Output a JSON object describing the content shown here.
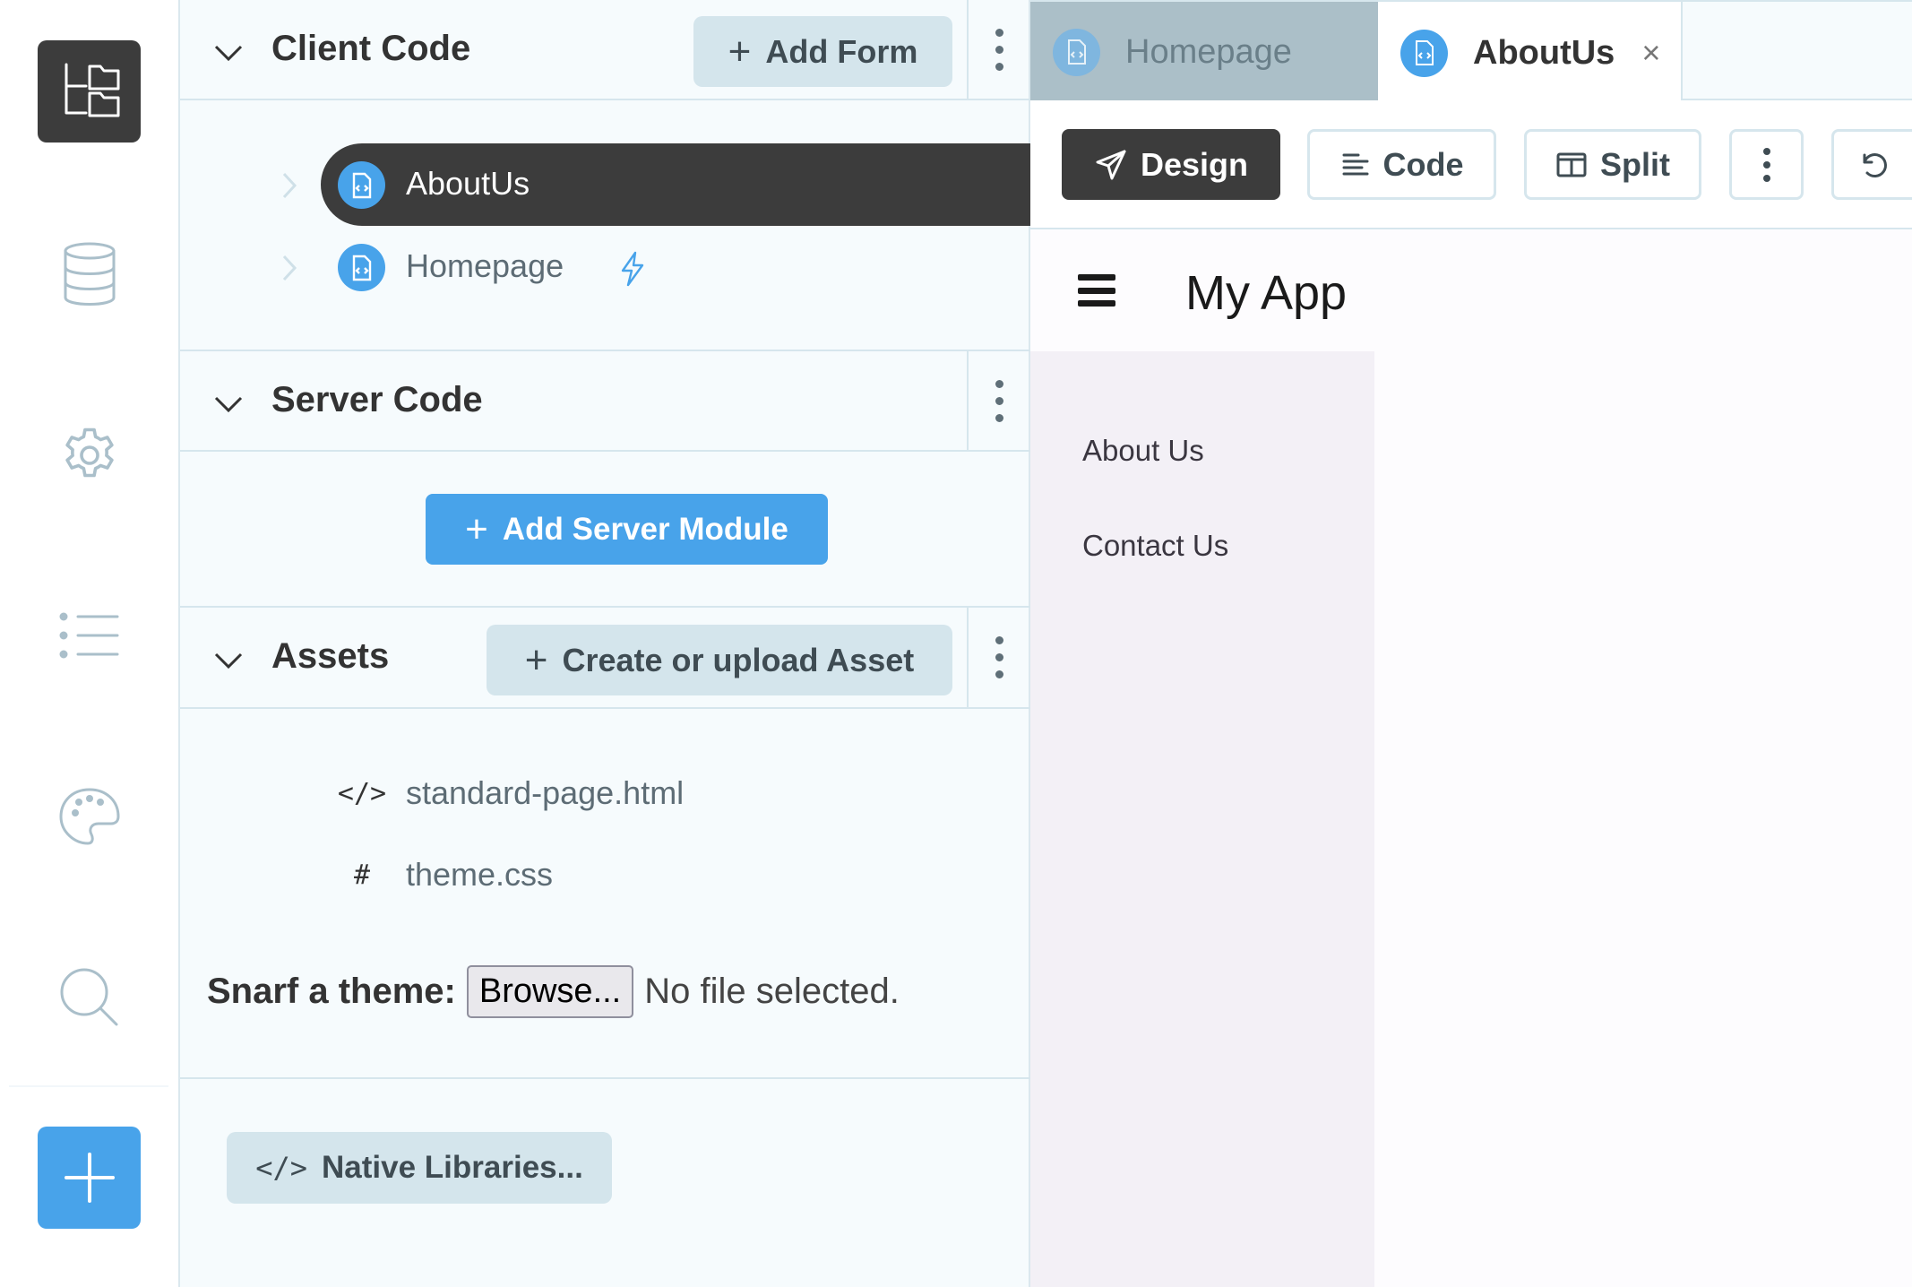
{
  "sidebar": {
    "items": [
      {
        "name": "files",
        "icon": "folder-tree-icon",
        "active": true
      },
      {
        "name": "data",
        "icon": "database-icon"
      },
      {
        "name": "settings",
        "icon": "gear-icon"
      },
      {
        "name": "list",
        "icon": "list-icon"
      },
      {
        "name": "theme",
        "icon": "palette-icon"
      },
      {
        "name": "search",
        "icon": "search-icon"
      }
    ],
    "add_icon": "plus-icon"
  },
  "client_code": {
    "title": "Client Code",
    "add_button": "Add Form",
    "forms": [
      {
        "label": "AboutUs",
        "selected": true
      },
      {
        "label": "Homepage",
        "startup": true,
        "startup_icon": "lightning-icon"
      }
    ]
  },
  "server_code": {
    "title": "Server Code",
    "add_button": "Add Server Module"
  },
  "assets": {
    "title": "Assets",
    "add_button": "Create or upload Asset",
    "files": [
      {
        "icon": "</>",
        "label": "standard-page.html"
      },
      {
        "icon": "#",
        "label": "theme.css"
      }
    ],
    "snarf_label": "Snarf a theme:",
    "browse_label": "Browse...",
    "no_file_text": "No file selected."
  },
  "native_libraries": {
    "icon": "</>",
    "label": "Native Libraries..."
  },
  "tabs": [
    {
      "label": "Homepage",
      "active": false
    },
    {
      "label": "AboutUs",
      "active": true,
      "close": "×"
    }
  ],
  "toolbar": {
    "design": "Design",
    "code": "Code",
    "split": "Split",
    "active": "Design"
  },
  "preview": {
    "app_title": "My App",
    "nav_links": [
      "About Us",
      "Contact Us"
    ]
  },
  "colors": {
    "accent": "#48a3ea",
    "dark": "#3c3c3c",
    "pale_button": "#d4e5ec",
    "panel_bg": "#f6fbfd",
    "preview_nav_bg": "#f3f0f6"
  }
}
